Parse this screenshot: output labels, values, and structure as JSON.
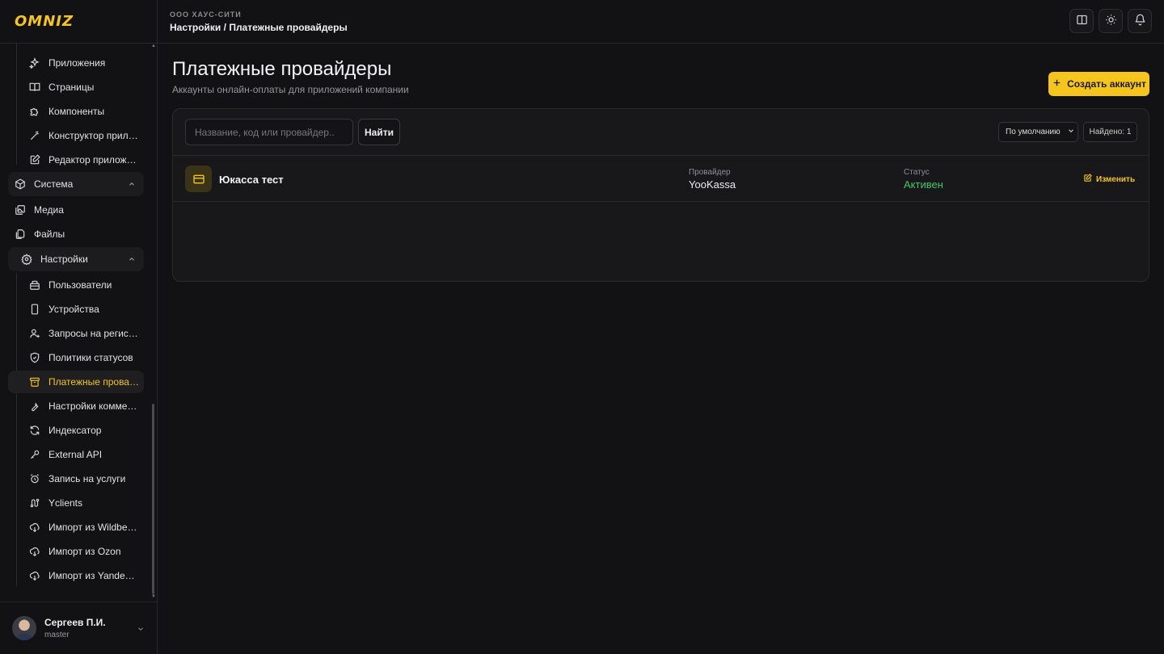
{
  "logo": "OMNIZ",
  "header": {
    "org": "ООО ХАУС-СИТИ",
    "breadcrumb": "Настройки / Платежные провайдеры"
  },
  "sidebar": {
    "items": [
      {
        "label": "Приложения",
        "icon": "sparkles-icon"
      },
      {
        "label": "Страницы",
        "icon": "book-icon"
      },
      {
        "label": "Компоненты",
        "icon": "puzzle-icon"
      },
      {
        "label": "Конструктор приложений",
        "icon": "wand-icon"
      },
      {
        "label": "Редактор приложений",
        "icon": "edit-icon"
      }
    ],
    "system": {
      "label": "Система",
      "items": [
        {
          "label": "Медиа",
          "icon": "images-icon"
        },
        {
          "label": "Файлы",
          "icon": "files-icon"
        }
      ]
    },
    "settings": {
      "label": "Настройки",
      "items": [
        {
          "label": "Пользователи",
          "icon": "users-icon"
        },
        {
          "label": "Устройства",
          "icon": "phone-icon"
        },
        {
          "label": "Запросы на регистрацию",
          "icon": "user-plus-icon"
        },
        {
          "label": "Политики статусов",
          "icon": "shield-icon"
        },
        {
          "label": "Платежные провайдеры",
          "icon": "archive-icon",
          "active": true
        },
        {
          "label": "Настройки коммерции",
          "icon": "wrench-icon"
        },
        {
          "label": "Индексатор",
          "icon": "refresh-icon"
        },
        {
          "label": "External API",
          "icon": "key-icon"
        },
        {
          "label": "Запись на услуги",
          "icon": "alarm-icon"
        },
        {
          "label": "Yclients",
          "icon": "route-icon"
        },
        {
          "label": "Импорт из Wildberries",
          "icon": "cloud-download-icon"
        },
        {
          "label": "Импорт из Ozon",
          "icon": "cloud-download-icon"
        },
        {
          "label": "Импорт из Yandex Market",
          "icon": "cloud-download-icon"
        }
      ]
    }
  },
  "user": {
    "name": "Сергеев П.И.",
    "role": "master"
  },
  "main": {
    "title": "Платежные провайдеры",
    "subtitle": "Аккаунты онлайн-оплаты для приложений компании",
    "create_label": "Создать аккаунт",
    "search_placeholder": "Название, код или провайдер..",
    "find_label": "Найти",
    "sort_value": "По умолчанию",
    "found_label": "Найдено: 1",
    "rows": [
      {
        "name": "Юкасса тест",
        "provider_label": "Провайдер",
        "provider": "YooKassa",
        "status_label": "Статус",
        "status": "Активен",
        "edit_label": "Изменить"
      }
    ]
  },
  "colors": {
    "accent": "#f5c51d",
    "status_active": "#45c46b",
    "background": "#121214"
  }
}
